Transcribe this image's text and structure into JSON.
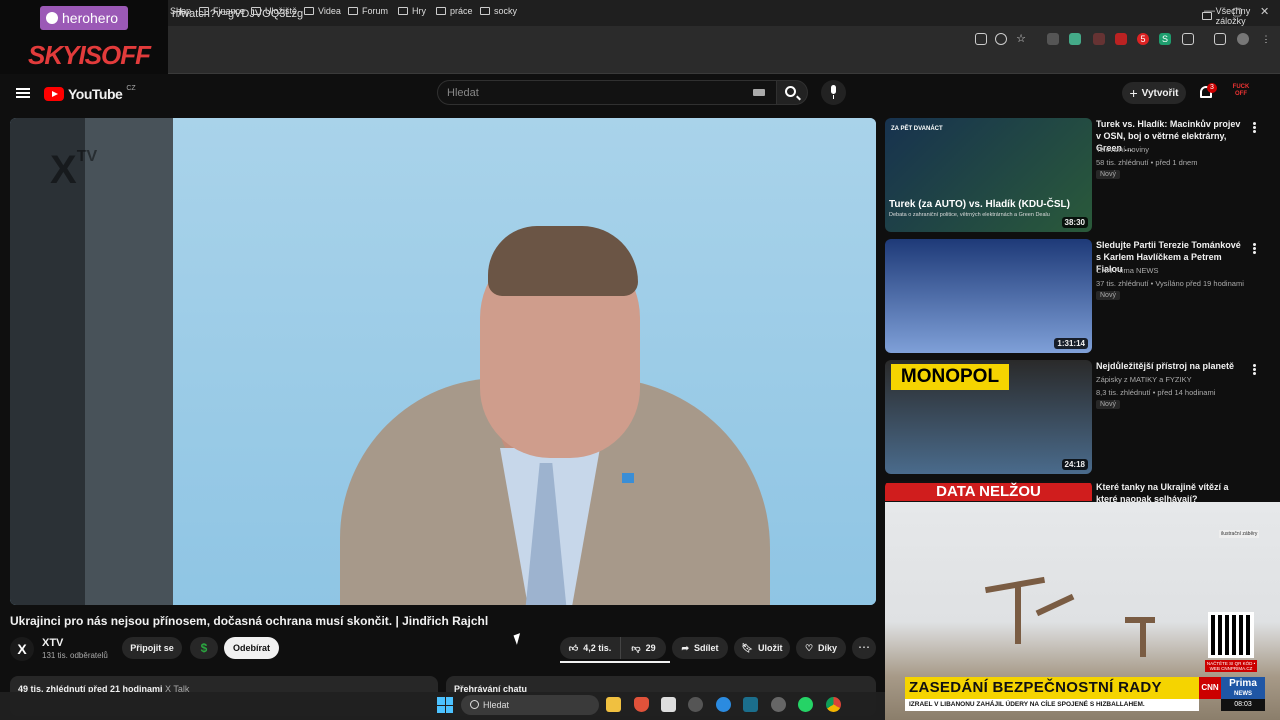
{
  "browser": {
    "url": "n/watch?v=gVDJVOQ3Lzg",
    "new_tab": "+",
    "bookmarks": [
      "Shop",
      "Finance",
      "Uložiště",
      "Videa",
      "Forum",
      "Hry",
      "práce",
      "socky"
    ],
    "all_bookmarks": "Všechny záložky",
    "extension_badge": "5"
  },
  "overlay": {
    "herohero": "herohero",
    "streamer": "SKYISOFF"
  },
  "youtube": {
    "brand": "YouTube",
    "country": "CZ",
    "search_placeholder": "Hledat",
    "create_label": "Vytvořit",
    "notif_count": "3",
    "account_text": "FUCK OFF"
  },
  "player": {
    "watermark": "X",
    "watermark_tv": "TV"
  },
  "video": {
    "title": "Ukrajinci pro nás nejsou přínosem, dočasná ochrana musí skončit. | Jindřich Rajchl",
    "channel": "XTV",
    "subscribers": "131 tis. odběratelů",
    "join": "Připojit se",
    "subscribe": "Odebírat",
    "likes": "4,2 tis.",
    "dislikes": "29",
    "share": "Sdílet",
    "save": "Uložit",
    "thanks": "Díky",
    "more": "⋯",
    "desc_stats": "49 tis. zhlédnutí  před 21 hodinami",
    "desc_tag": "X Talk",
    "chat_label": "Přehrávání chatu"
  },
  "recommendations": [
    {
      "title": "Turek vs. Hladík: Macinkův projev v OSN, boj o větrné elektrárny, Green ...",
      "channel": "Televizní noviny",
      "meta": "58 tis. zhlédnutí • před 1 dnem",
      "badge": "Nový",
      "duration": "38:30",
      "thumb_caption": "Turek (za AUTO) vs. Hladík (KDU-ČSL)",
      "thumb_sub": "Debata o zahraniční politice, větrných elektrárnách a Green Dealu",
      "thumb_logo": "ZA PĚT DVANÁCT"
    },
    {
      "title": "Sledujte Partii Terezie Tománkové s Karlem Havlíčkem a Petrem Fialou",
      "channel": "CNN Prima NEWS",
      "meta": "37 tis. zhlédnutí • Vysíláno před 19 hodinami",
      "badge": "Nový",
      "duration": "1:31:14"
    },
    {
      "title": "Nejdůležitější přístroj na planetě",
      "channel": "Zápisky z MATIKY a FYZIKY",
      "meta": "8,3 tis. zhlédnutí • před 14 hodinami",
      "badge": "Nový",
      "duration": "24:18",
      "thumb_caption": "MONOPOL"
    },
    {
      "title": "Které tanky na Ukrajině vítězí a které naopak selhávají?",
      "thumb_caption": "DATA NELŽOU"
    }
  ],
  "pip": {
    "watermark": "ilustrační záběry",
    "headline": "ZASEDÁNÍ BEZPEČNOSTNÍ RADY",
    "ticker": "IZRAEL V LIBANONU ZAHÁJIL ÚDERY NA CÍLE SPOJENÉ S HIZBALLAHEM.",
    "cnn": "CNN",
    "prima": "Prima",
    "prima_news": "NEWS",
    "clock": "08:03",
    "qr_text": "NAČTĚTE SI QR KÓD • WEB CNNPRIMA.CZ"
  },
  "taskbar": {
    "search": "Hledat"
  },
  "colors": {
    "yt_red": "#ff0000",
    "cnn_yellow": "#f5d400",
    "subscribe_bg": "#f1f1f1"
  }
}
